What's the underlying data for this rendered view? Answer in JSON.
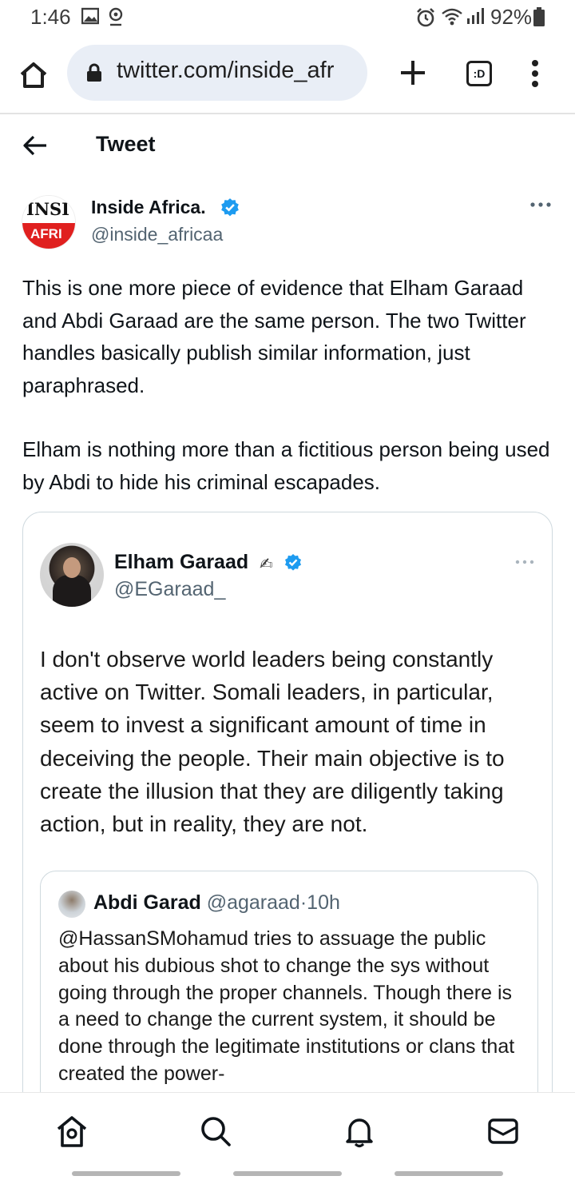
{
  "status_bar": {
    "time": "1:46",
    "battery": "92%",
    "icons": [
      "gallery-icon",
      "location-icon",
      "alarm-icon",
      "wifi-icon",
      "signal-icon",
      "battery-icon"
    ]
  },
  "browser": {
    "url": "twitter.com/inside_afr",
    "tabs_label": ":D"
  },
  "header": {
    "title": "Tweet"
  },
  "tweet": {
    "avatar_top": "INSI",
    "avatar_bottom": "AFRI",
    "author_name": "Inside Africa.",
    "author_handle": "@inside_africaa",
    "paragraphs": [
      "This is one more piece of evidence that Elham Garaad and Abdi Garaad are the same person. The two Twitter handles basically publish similar information, just paraphrased.",
      "Elham is nothing more than a fictitious person being used by Abdi to hide his criminal escapades."
    ]
  },
  "quoted": {
    "name": "Elham Garaad",
    "pen_glyph": "✍",
    "handle": "@EGaraad_",
    "text": "I don't observe world leaders being constantly active on Twitter. Somali leaders, in particular, seem to invest a significant amount of time in deceiving the people. Their main objective is to create the illusion that they are diligently taking action, but in reality, they are not.",
    "nested": {
      "name": "Abdi Garad",
      "handle": "@agaraad",
      "time": "10h",
      "separator": "·",
      "text": "@HassanSMohamud tries to assuage the public about his dubious shot to change the sys without going through the proper channels. Though there is a need to change the current system, it should be done through the legitimate institutions or clans that created the power-"
    }
  },
  "colors": {
    "verified": "#1d9bf0",
    "muted_text": "#536471",
    "url_bar": "#e9eef6"
  }
}
